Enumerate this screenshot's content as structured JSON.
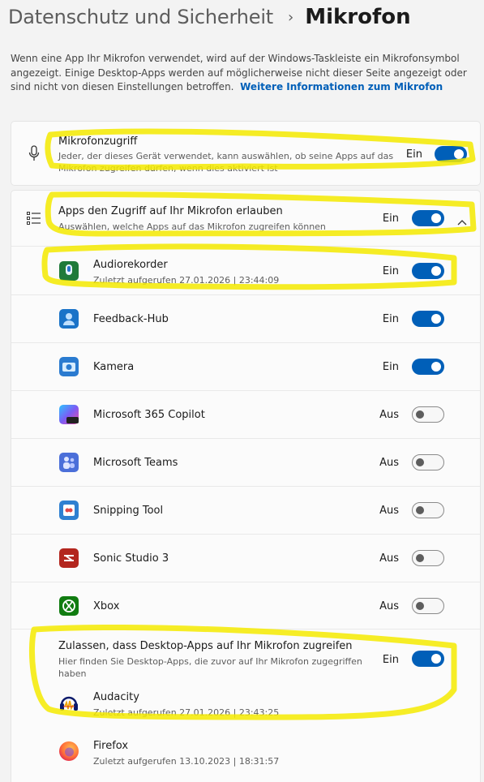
{
  "breadcrumb": {
    "parent": "Datenschutz und Sicherheit",
    "separator": "›",
    "current": "Mikrofon"
  },
  "intro": {
    "text": "Wenn eine App Ihr Mikrofon verwendet, wird auf der Windows-Taskleiste ein Mikrofonsymbol angezeigt. Einige Desktop-Apps werden auf möglicherweise nicht dieser Seite angezeigt oder sind nicht von diesen Einstellungen betroffen.",
    "link": "Weitere Informationen zum Mikrofon"
  },
  "mic_access": {
    "title": "Mikrofonzugriff",
    "subtitle": "Jeder, der dieses Gerät verwendet, kann auswählen, ob seine Apps auf das Mikrofon zugreifen dürfen, wenn dies aktiviert ist",
    "state": "Ein",
    "on": true,
    "icon": "microphone-icon"
  },
  "app_access": {
    "title": "Apps den Zugriff auf Ihr Mikrofon erlauben",
    "subtitle": "Auswählen, welche Apps auf das Mikrofon zugreifen können",
    "state": "Ein",
    "on": true,
    "icon": "list-icon",
    "expand_icon": "chevron-up-icon"
  },
  "apps": [
    {
      "name": "Audiorekorder",
      "last": "Zuletzt aufgerufen 27.01.2026  |  23:44:09",
      "state": "Ein",
      "on": true,
      "icon": "audio-recorder-icon",
      "color": "#1f7a3a"
    },
    {
      "name": "Feedback-Hub",
      "last": "",
      "state": "Ein",
      "on": true,
      "icon": "feedback-hub-icon",
      "color": "#1a73c8"
    },
    {
      "name": "Kamera",
      "last": "",
      "state": "Ein",
      "on": true,
      "icon": "camera-icon",
      "color": "#2a7bd0"
    },
    {
      "name": "Microsoft 365 Copilot",
      "last": "",
      "state": "Aus",
      "on": false,
      "icon": "copilot-icon",
      "color": "#7b5cf5"
    },
    {
      "name": "Microsoft Teams",
      "last": "",
      "state": "Aus",
      "on": false,
      "icon": "teams-icon",
      "color": "#4b6fd9"
    },
    {
      "name": "Snipping Tool",
      "last": "",
      "state": "Aus",
      "on": false,
      "icon": "snipping-tool-icon",
      "color": "#2f80d1"
    },
    {
      "name": "Sonic Studio 3",
      "last": "",
      "state": "Aus",
      "on": false,
      "icon": "sonic-studio-icon",
      "color": "#b3261e"
    },
    {
      "name": "Xbox",
      "last": "",
      "state": "Aus",
      "on": false,
      "icon": "xbox-icon",
      "color": "#107c10"
    }
  ],
  "desktop_apps": {
    "title": "Zulassen, dass Desktop-Apps auf Ihr Mikrofon zugreifen",
    "subtitle": "Hier finden Sie Desktop-Apps, die zuvor auf Ihr Mikrofon zugegriffen haben",
    "state": "Ein",
    "on": true,
    "items": [
      {
        "name": "Audacity",
        "last": "Zuletzt aufgerufen 27.01.2026  |  23:43:25",
        "icon": "audacity-icon"
      },
      {
        "name": "Firefox",
        "last": "Zuletzt aufgerufen 13.10.2023  |  18:31:57",
        "icon": "firefox-icon"
      }
    ]
  },
  "colors": {
    "accent": "#005fb8",
    "highlighter": "#f5ea00",
    "background": "#f3f3f3"
  }
}
